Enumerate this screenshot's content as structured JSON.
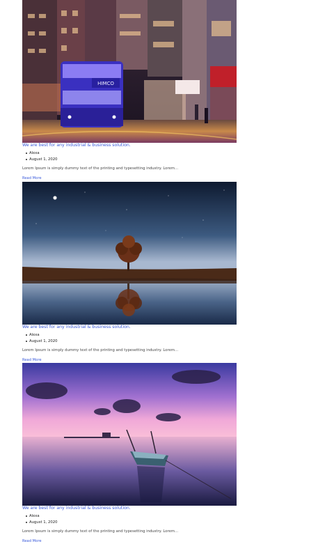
{
  "posts": [
    {
      "image_alt": "Night street with double-decker tram",
      "title": "We are best for any industrial & business solution.",
      "author": "Alexa",
      "date": "August 1, 2020",
      "excerpt": "Lorem Ipsum is simply dummy text of the printing and typesetting industry. Lorem...",
      "read_more": "Read More",
      "tram_sign": "HIMCO"
    },
    {
      "image_alt": "Lone tree reflected in still water under night sky",
      "title": "We are best for any industrial & business solution.",
      "author": "Alexa",
      "date": "August 1, 2020",
      "excerpt": "Lorem Ipsum is simply dummy text of the printing and typesetting industry. Lorem...",
      "read_more": "Read More"
    },
    {
      "image_alt": "Boat on calm water at purple sunset",
      "title": "We are best for any industrial & business solution.",
      "author": "Alexa",
      "date": "August 1, 2020",
      "excerpt": "Lorem Ipsum is simply dummy text of the printing and typesetting industry. Lorem...",
      "read_more": "Read More"
    }
  ],
  "colors": {
    "link": "#3b5bdb",
    "text": "#333333",
    "background": "#ffffff"
  }
}
